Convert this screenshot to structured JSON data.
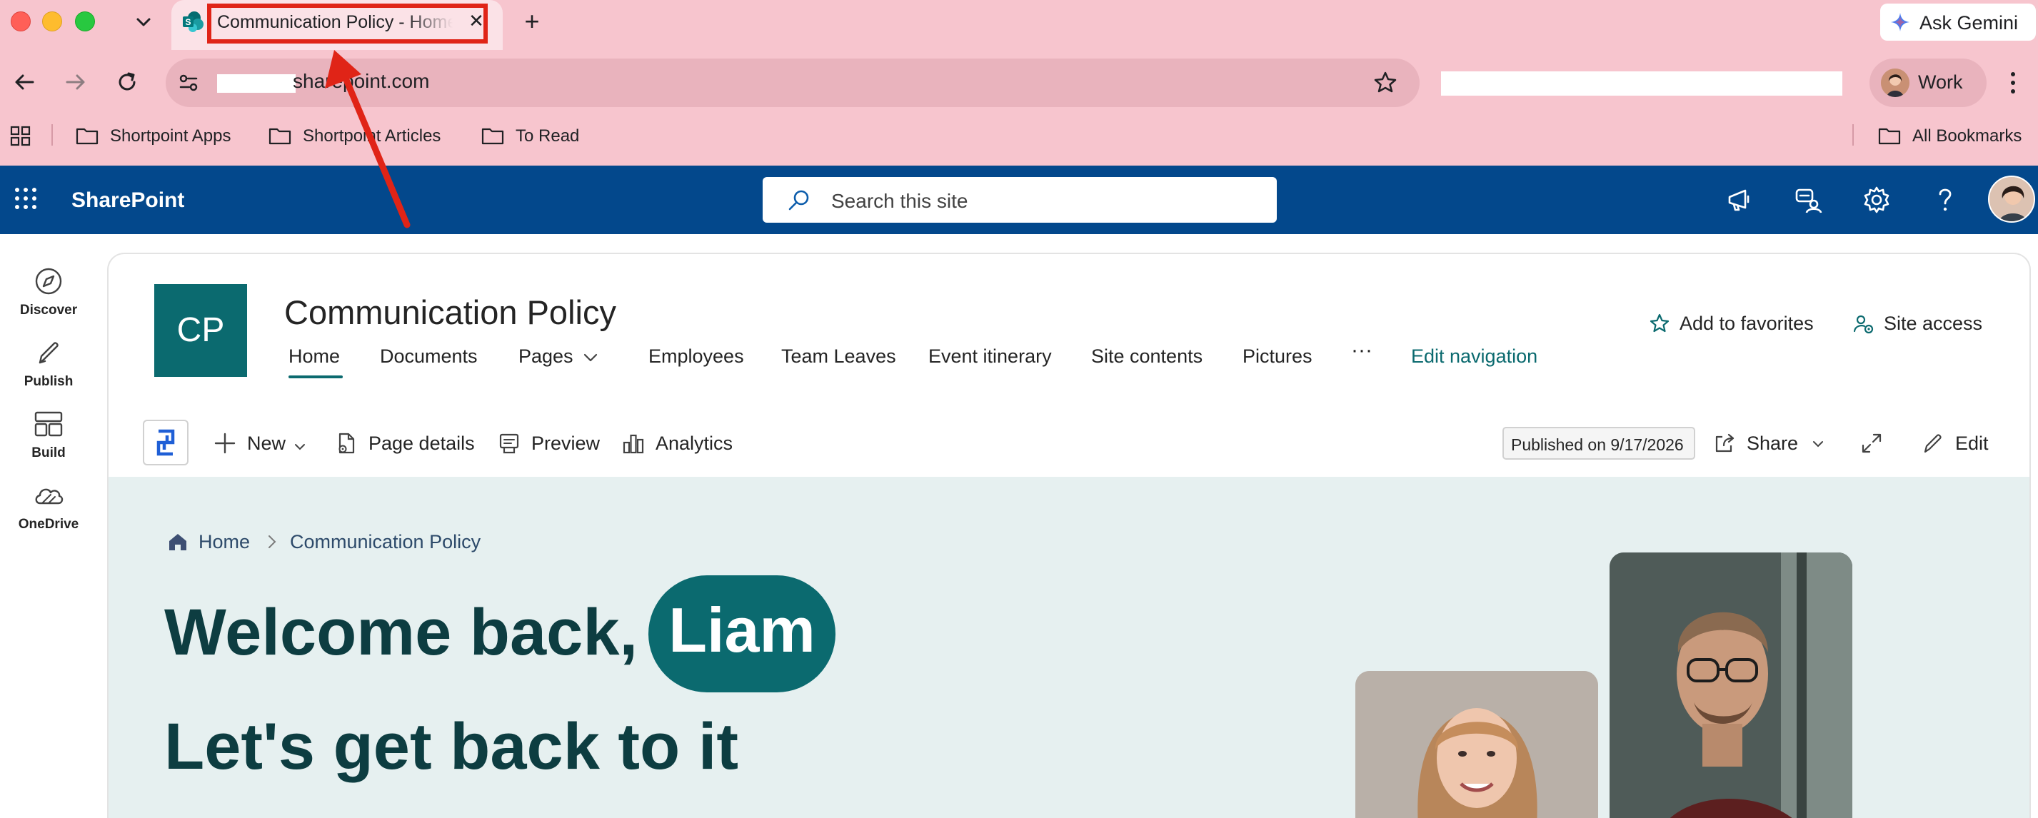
{
  "browser": {
    "tab_title": "Communication Policy - Home",
    "url": "sharepoint.com",
    "ask_gemini": "Ask Gemini",
    "profile": "Work",
    "bookmarks": [
      "Shortpoint Apps",
      "Shortpoint Articles",
      "To Read"
    ],
    "all_bookmarks": "All Bookmarks",
    "annotation_color": "#e02417"
  },
  "suite": {
    "brand": "SharePoint",
    "search_placeholder": "Search this site",
    "bar_color": "#03488c"
  },
  "appbar": [
    "Discover",
    "Publish",
    "Build",
    "OneDrive"
  ],
  "site": {
    "logo": "CP",
    "title": "Communication Policy",
    "nav": [
      "Home",
      "Documents",
      "Pages",
      "Employees",
      "Team Leaves",
      "Event itinerary",
      "Site contents",
      "Pictures"
    ],
    "more": "···",
    "edit_nav": "Edit navigation",
    "add_favorites": "Add to favorites",
    "site_access": "Site access",
    "accent": "#0b6a6f"
  },
  "commandbar": {
    "new": "New",
    "page_details": "Page details",
    "preview": "Preview",
    "analytics": "Analytics",
    "published": "Published on 9/17/2026",
    "share": "Share",
    "edit": "Edit"
  },
  "hero": {
    "breadcrumb_home": "Home",
    "breadcrumb_current": "Communication Policy",
    "welcome": "Welcome back,",
    "name": "Liam",
    "subtitle": "Let's get back to it"
  }
}
